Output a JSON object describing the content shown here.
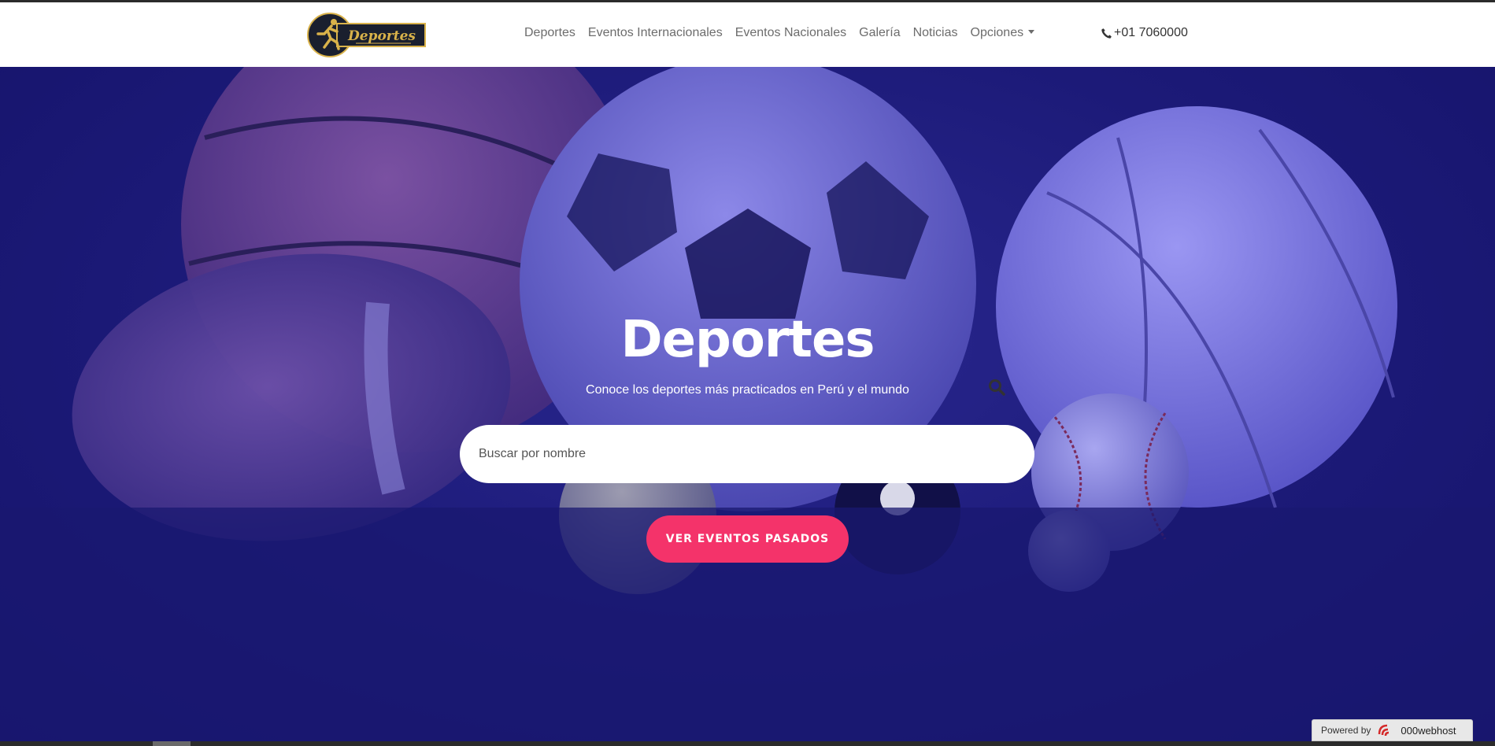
{
  "navbar": {
    "logo_text": "Deportes",
    "links": [
      {
        "label": "Deportes"
      },
      {
        "label": "Eventos Internacionales"
      },
      {
        "label": "Eventos Nacionales"
      },
      {
        "label": "Galería"
      },
      {
        "label": "Noticias"
      }
    ],
    "dropdown_label": "Opciones",
    "phone": "+01 7060000",
    "phone_icon": "phone-icon"
  },
  "hero": {
    "title": "Deportes",
    "subtitle": "Conoce los deportes más practicados en Perú y el mundo",
    "search_placeholder": "Buscar por nombre",
    "search_icon": "search-icon",
    "cta_label": "VER EVENTOS PASADOS"
  },
  "badge": {
    "prefix": "Powered by",
    "brand": "000webhost"
  },
  "colors": {
    "hero_bg": "#1c1a78",
    "cta": "#f4336a",
    "nav_text": "#6c6c6c",
    "logo_gold": "#d9b24a",
    "logo_dark": "#1a1f2e"
  }
}
